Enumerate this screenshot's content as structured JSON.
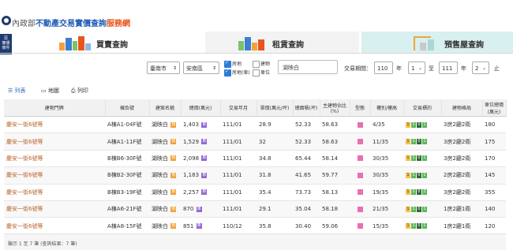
{
  "header": {
    "ministry": "內政部",
    "title_main": "不動產交易實價查詢",
    "title_suffix": "服務網",
    "side_button": "實價\n登錄\n條件"
  },
  "tabs": [
    {
      "label": "買賣查詢"
    },
    {
      "label": "租賃查詢"
    },
    {
      "label": "預售屋查詢"
    }
  ],
  "filters": {
    "city": "臺南市",
    "district": "安南區",
    "checkboxes": [
      {
        "label": "房地",
        "checked": true
      },
      {
        "label": "建物",
        "checked": false
      },
      {
        "label": "房地(車)",
        "checked": true
      },
      {
        "label": "車位",
        "checked": false
      }
    ],
    "search_value": "湖映白",
    "period_label": "交易期間：",
    "from_year": "110",
    "year_label1": "年",
    "from_month": "1",
    "to_label": "至",
    "to_year": "111",
    "year_label2": "年",
    "to_month": "2",
    "end_label": "止"
  },
  "view": {
    "list": "列表",
    "map": "地圖",
    "print": "列印"
  },
  "table": {
    "headers": [
      "建物門牌",
      "棟及號",
      "建案名稱",
      "總價(萬元)",
      "交易年月",
      "單價(萬元/坪)",
      "總面積(坪)",
      "主建物佔比(%)",
      "型態",
      "樓別/樓高",
      "交易標的",
      "建物格局",
      "車位總價(萬元)"
    ],
    "rows": [
      {
        "addr": "慶安一街6號等",
        "unit": "A棟A1-04F號",
        "name": "湖映白",
        "price": "1,403",
        "ym": "111/01",
        "unit_price": "28.9",
        "area": "52.33",
        "ratio": "58.63",
        "floor": "4/35",
        "layout": "3房2廳2衛",
        "park": "180",
        "tx": [
          "1",
          "1",
          "0",
          "1"
        ]
      },
      {
        "addr": "慶安一街6號等",
        "unit": "A棟A1-11F號",
        "name": "湖映白",
        "price": "1,529",
        "ym": "111/01",
        "unit_price": "32",
        "area": "52.33",
        "ratio": "58.63",
        "floor": "11/35",
        "layout": "3房2廳2衛",
        "park": "175",
        "tx": [
          "1",
          "1",
          "0",
          "1"
        ]
      },
      {
        "addr": "慶安一街6號等",
        "unit": "B棟B6-30F號",
        "name": "湖映白",
        "price": "2,098",
        "ym": "111/01",
        "unit_price": "34.8",
        "area": "65.44",
        "ratio": "58.14",
        "floor": "30/35",
        "layout": "3房2廳2衛",
        "park": "170",
        "tx": [
          "1",
          "1",
          "0",
          "1"
        ]
      },
      {
        "addr": "慶安一街6號等",
        "unit": "B棟B2-30F號",
        "name": "湖映白",
        "price": "1,183",
        "ym": "111/01",
        "unit_price": "31.8",
        "area": "41.65",
        "ratio": "59.77",
        "floor": "30/35",
        "layout": "2房2廳2衛",
        "park": "145",
        "tx": [
          "1",
          "1",
          "0",
          "1"
        ]
      },
      {
        "addr": "慶安一街6號等",
        "unit": "B棟B3-19F號",
        "name": "湖映白",
        "price": "2,257",
        "ym": "111/01",
        "unit_price": "35.4",
        "area": "73.73",
        "ratio": "58.13",
        "floor": "19/35",
        "layout": "3房2廳2衛",
        "park": "355",
        "tx": [
          "1",
          "1",
          "0",
          "2"
        ]
      },
      {
        "addr": "慶安一街6號等",
        "unit": "A棟A6-21F號",
        "name": "湖映白",
        "price": "870",
        "ym": "111/01",
        "unit_price": "29.1",
        "area": "35.04",
        "ratio": "58.18",
        "floor": "21/35",
        "layout": "1房2廳1衛",
        "park": "140",
        "tx": [
          "1",
          "1",
          "0",
          "1"
        ]
      },
      {
        "addr": "慶安一街6號等",
        "unit": "A棟A8-15F號",
        "name": "湖映白",
        "price": "851",
        "ym": "110/12",
        "unit_price": "35.8",
        "area": "30.40",
        "ratio": "59.06",
        "floor": "15/35",
        "layout": "1房2廳1衛",
        "park": "120",
        "tx": [
          "1",
          "1",
          "0",
          "1"
        ]
      }
    ]
  },
  "footer": {
    "text": "顯示 1 至 7 筆 (查詢結果：7 筆)"
  },
  "colors": {
    "brand_blue": "#1f5bb8",
    "brand_orange": "#e8541c",
    "address_link": "#b8632c"
  }
}
